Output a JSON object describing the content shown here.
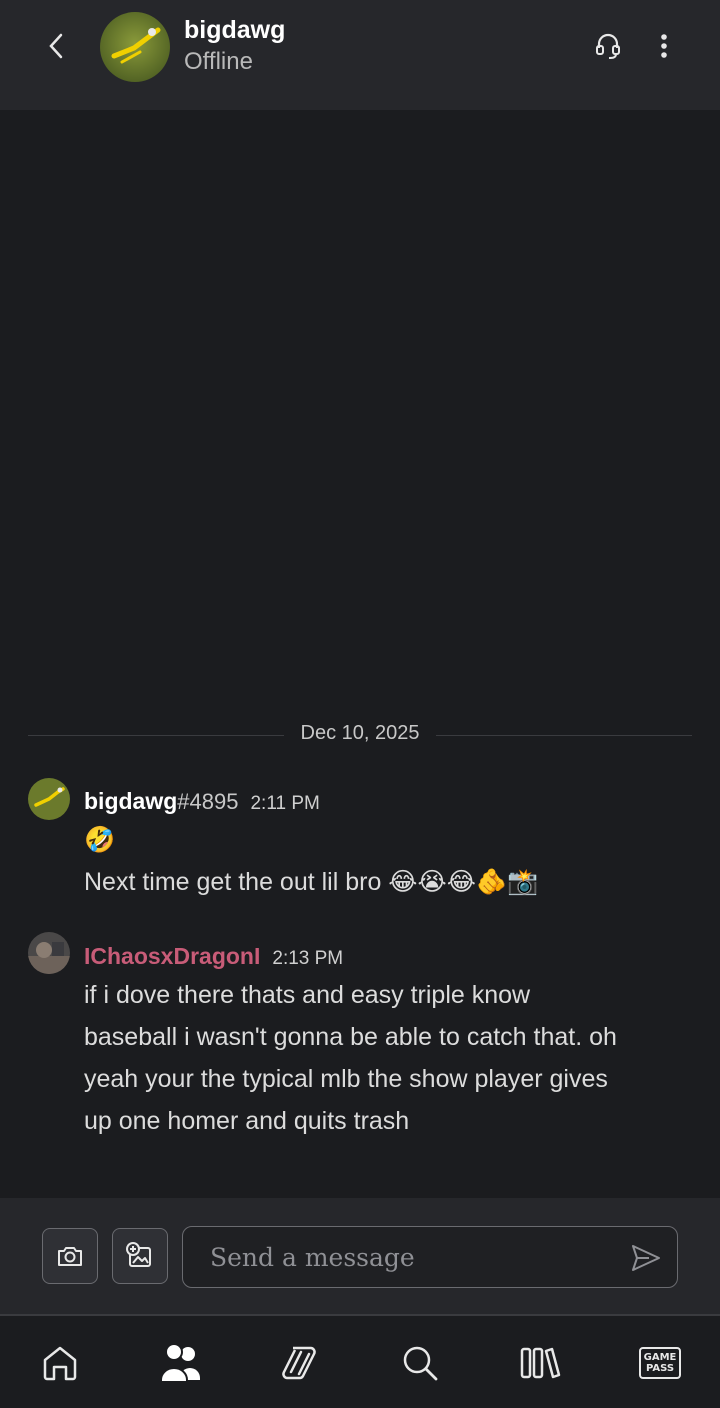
{
  "header": {
    "name": "bigdawg",
    "status": "Offline",
    "back_icon": "chevron-left-icon",
    "voice_icon": "headset-icon",
    "more_icon": "more-vertical-icon"
  },
  "date_separator": "Dec 10, 2025",
  "messages": [
    {
      "name": "bigdawg",
      "tag": "#4895",
      "time": "2:11 PM",
      "name_color": "#ffffff",
      "lines": [
        "🤣",
        "Next time get the out lil bro 😂😭😂🫵📸"
      ]
    },
    {
      "name": "IChaosxDragonI",
      "time": "2:13 PM",
      "name_color": "#c85c78",
      "lines": [
        "if i dove there thats and easy triple know",
        "baseball i wasn't gonna be able to catch that. oh",
        "yeah your the typical mlb the show player gives",
        "up one homer and quits trash"
      ]
    }
  ],
  "composer": {
    "placeholder": "Send a message",
    "camera_icon": "camera-icon",
    "gallery_icon": "add-image-icon",
    "send_icon": "send-icon"
  },
  "nav": {
    "items": [
      "home-icon",
      "friends-icon",
      "cloud-gaming-icon",
      "search-icon",
      "library-icon",
      "game-pass-icon"
    ],
    "game_pass_label_1": "GAME",
    "game_pass_label_2": "PASS"
  },
  "colors": {
    "background": "#1b1c1f",
    "header": "#26272b",
    "accent_name": "#c85c78"
  }
}
